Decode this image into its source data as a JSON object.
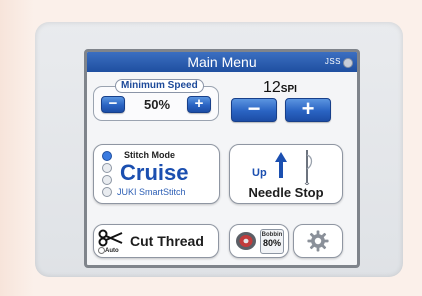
{
  "window": {
    "title": "Main Menu",
    "user": "JSS"
  },
  "speed": {
    "label": "Minimum Speed",
    "value": "50%",
    "minus_label": "−",
    "plus_label": "+"
  },
  "spi": {
    "value": "12",
    "unit": "SPI",
    "minus_label": "−",
    "plus_label": "+"
  },
  "stitch": {
    "title": "Stitch Mode",
    "mode": "Cruise",
    "sub": "JUKI SmartStitch",
    "options_selected": 0
  },
  "needle": {
    "position": "Up",
    "label": "Needle Stop"
  },
  "cut": {
    "auto_label": "Auto",
    "label": "Cut Thread"
  },
  "bobbin": {
    "title": "Bobbin",
    "percent": "80%"
  },
  "colors": {
    "accent": "#1f4fa0",
    "button_blue": "#2a63c2"
  },
  "icons": [
    "scissors-icon",
    "bobbin-icon",
    "gear-icon",
    "needle-icon",
    "up-arrow-icon"
  ]
}
